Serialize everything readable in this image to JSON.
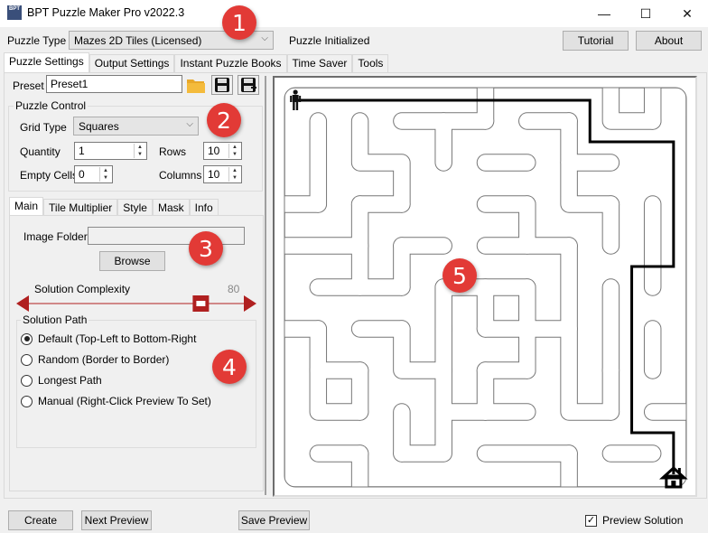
{
  "window": {
    "title": "BPT Puzzle Maker Pro v2022.3",
    "app_icon_text": "BPT",
    "minimize": "—",
    "maximize": "☐",
    "close": "✕"
  },
  "toolbar": {
    "puzzle_type_label": "Puzzle Type",
    "puzzle_type_value": "Mazes 2D Tiles (Licensed)",
    "status": "Puzzle Initialized",
    "tutorial_label": "Tutorial",
    "about_label": "About"
  },
  "main_tabs": [
    {
      "label": "Puzzle Settings",
      "active": true
    },
    {
      "label": "Output Settings",
      "active": false
    },
    {
      "label": "Instant Puzzle Books",
      "active": false
    },
    {
      "label": "Time Saver",
      "active": false
    },
    {
      "label": "Tools",
      "active": false
    }
  ],
  "preset": {
    "label": "Preset",
    "value": "Preset1",
    "icons": [
      "folder-open-icon",
      "save-icon",
      "save-as-icon"
    ]
  },
  "puzzle_control": {
    "title": "Puzzle Control",
    "grid_type_label": "Grid Type",
    "grid_type_value": "Squares",
    "quantity_label": "Quantity",
    "quantity_value": "1",
    "rows_label": "Rows",
    "rows_value": "10",
    "empty_cells_label": "Empty Cells",
    "empty_cells_value": "0",
    "columns_label": "Columns",
    "columns_value": "10"
  },
  "sub_tabs": [
    {
      "label": "Main",
      "active": true
    },
    {
      "label": "Tile Multiplier",
      "active": false
    },
    {
      "label": "Style",
      "active": false
    },
    {
      "label": "Mask",
      "active": false
    },
    {
      "label": "Info",
      "active": false
    }
  ],
  "main_tab": {
    "image_folder_label": "Image Folder",
    "image_folder_value": "",
    "browse_label": "Browse",
    "complexity_label": "Solution Complexity",
    "complexity_value": "80",
    "complexity_fraction": 0.8,
    "slider_color": "#b02020"
  },
  "solution_path": {
    "title": "Solution Path",
    "options": [
      {
        "label": "Default (Top-Left to Bottom-Right",
        "selected": true
      },
      {
        "label": "Random (Border to Border)",
        "selected": false
      },
      {
        "label": "Longest Path",
        "selected": false
      },
      {
        "label": "Manual (Right-Click Preview To Set)",
        "selected": false
      }
    ]
  },
  "badges": [
    "1",
    "2",
    "3",
    "4",
    "5"
  ],
  "badge_color": "#e23a36",
  "maze": {
    "rows": 10,
    "columns": 10,
    "start_icon": "person-icon",
    "end_icon": "house-icon",
    "solution_cells": [
      [
        0,
        0
      ],
      [
        0,
        7
      ],
      [
        1,
        7
      ],
      [
        1,
        9
      ],
      [
        4,
        9
      ],
      [
        4,
        8
      ],
      [
        8,
        8
      ],
      [
        8,
        9
      ],
      [
        9,
        9
      ]
    ]
  },
  "bottom": {
    "create_label": "Create",
    "next_preview_label": "Next Preview",
    "save_preview_label": "Save Preview",
    "preview_solution_label": "Preview Solution",
    "preview_solution_checked": true
  }
}
